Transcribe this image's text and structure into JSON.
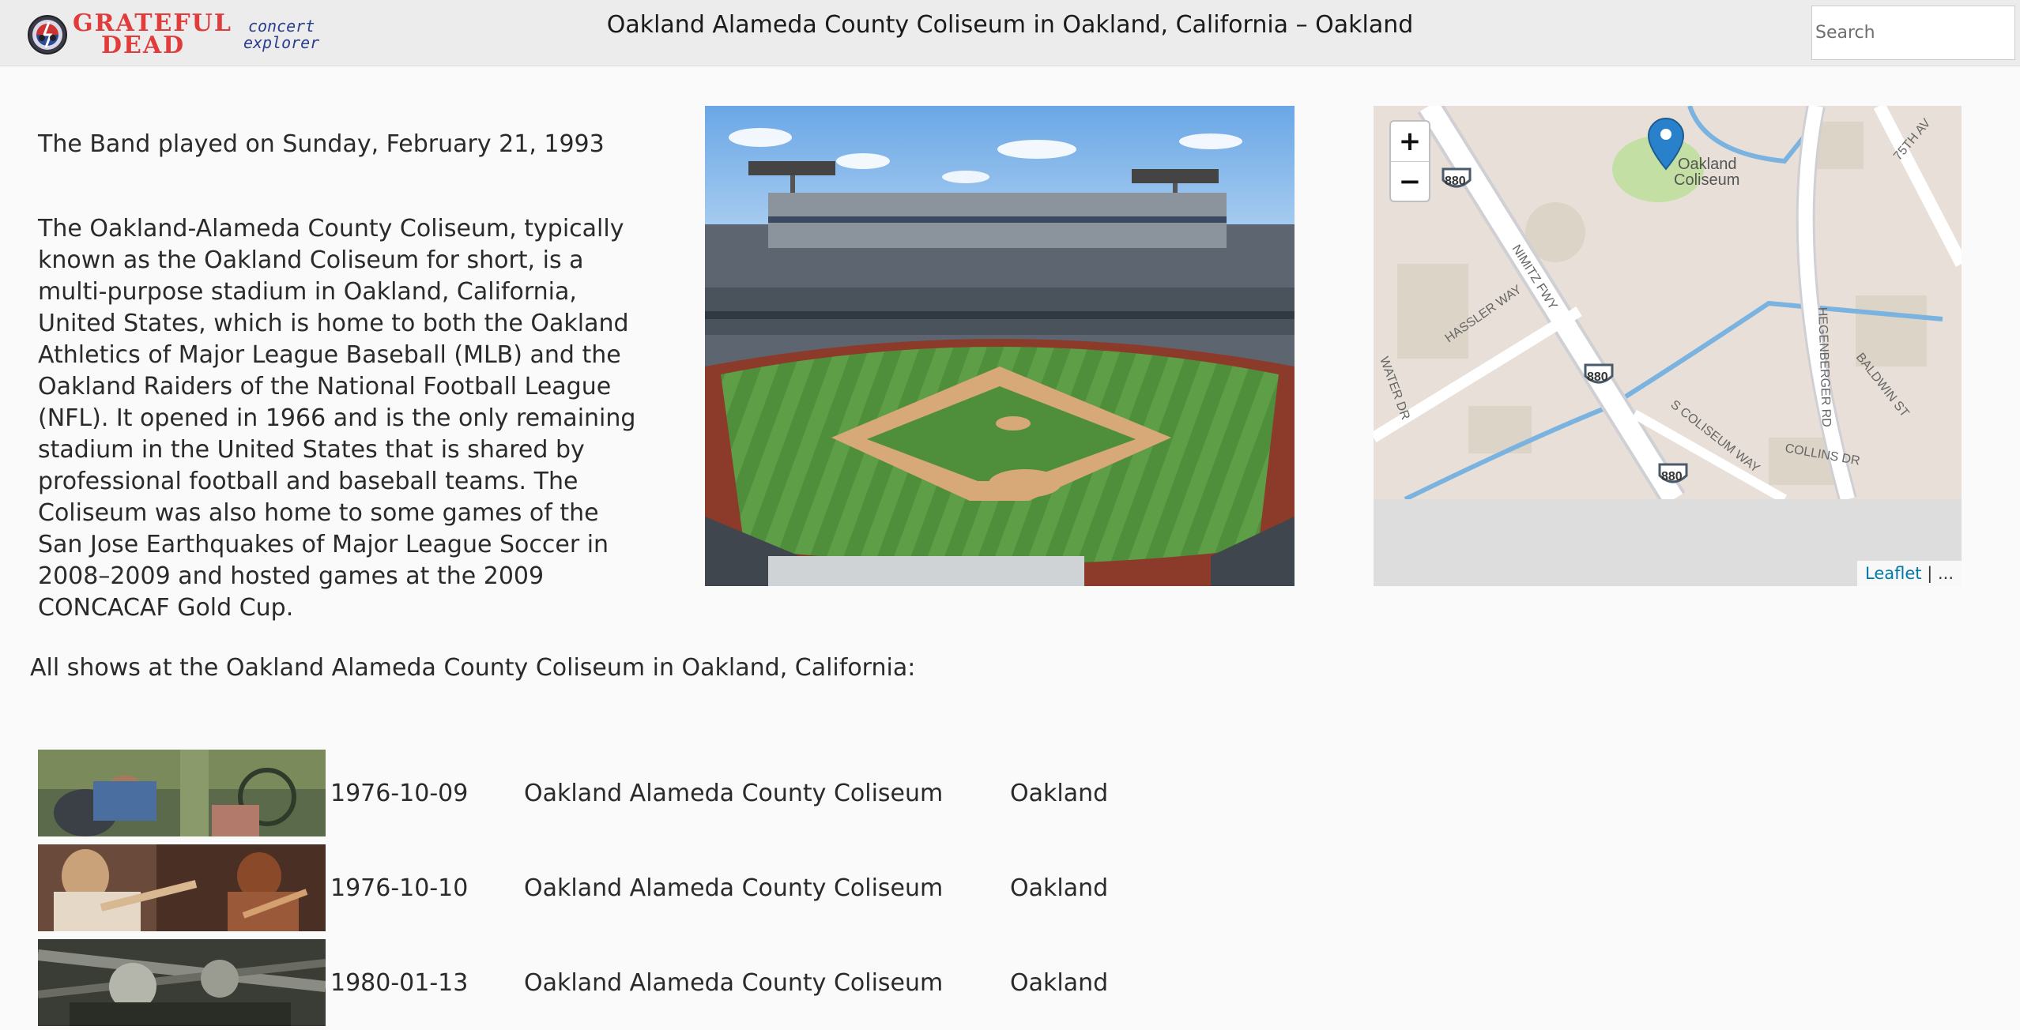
{
  "header": {
    "logo_line1": "GRATEFUL",
    "logo_line2": "DEAD",
    "logo_sub1": "concert",
    "logo_sub2": "explorer",
    "title": "Oakland Alameda County Coliseum in Oakland, California – Oakland",
    "search_placeholder": "Search"
  },
  "venue": {
    "played": "The Band played on Sunday, February 21, 1993",
    "description": "The Oakland-Alameda County Coliseum, typically known as the Oakland Coliseum for short, is a multi-purpose stadium in Oakland, California, United States, which is home to both the Oakland Athletics of Major League Baseball (MLB) and the Oakland Raiders of the National Football League (NFL). It opened in 1966 and is the only remaining stadium in the United States that is shared by professional football and baseball teams. The Coliseum was also home to some games of the San Jose Earthquakes of Major League Soccer in 2008–2009 and hosted games at the 2009 CONCACAF Gold Cup."
  },
  "map": {
    "zoom_in": "+",
    "zoom_out": "−",
    "attribution_link": "Leaflet",
    "attribution_rest": " | ...",
    "labels": {
      "poi": "Oakland",
      "poi2": "Coliseum",
      "street1": "NIMITZ FWY",
      "street2": "HASSLER WAY",
      "street3": "S COLISEUM WAY",
      "street4": "HEGENBERGER RD",
      "street5": "BALDWIN ST",
      "street6": "COLLINS DR",
      "street7": "75TH AV",
      "street8": "WATER DR",
      "highway": "880"
    },
    "colors": {
      "land": "#e8e0d8",
      "road": "#ffffff",
      "water": "#7ab2e0",
      "park": "#c3dfa4",
      "marker": "#2a81cb"
    }
  },
  "shows_heading": "All shows at the Oakland Alameda County Coliseum in Oakland, California:",
  "shows": [
    {
      "date": "1976-10-09",
      "venue": "Oakland Alameda County Coliseum",
      "city": "Oakland"
    },
    {
      "date": "1976-10-10",
      "venue": "Oakland Alameda County Coliseum",
      "city": "Oakland"
    },
    {
      "date": "1980-01-13",
      "venue": "Oakland Alameda County Coliseum",
      "city": "Oakland"
    }
  ]
}
